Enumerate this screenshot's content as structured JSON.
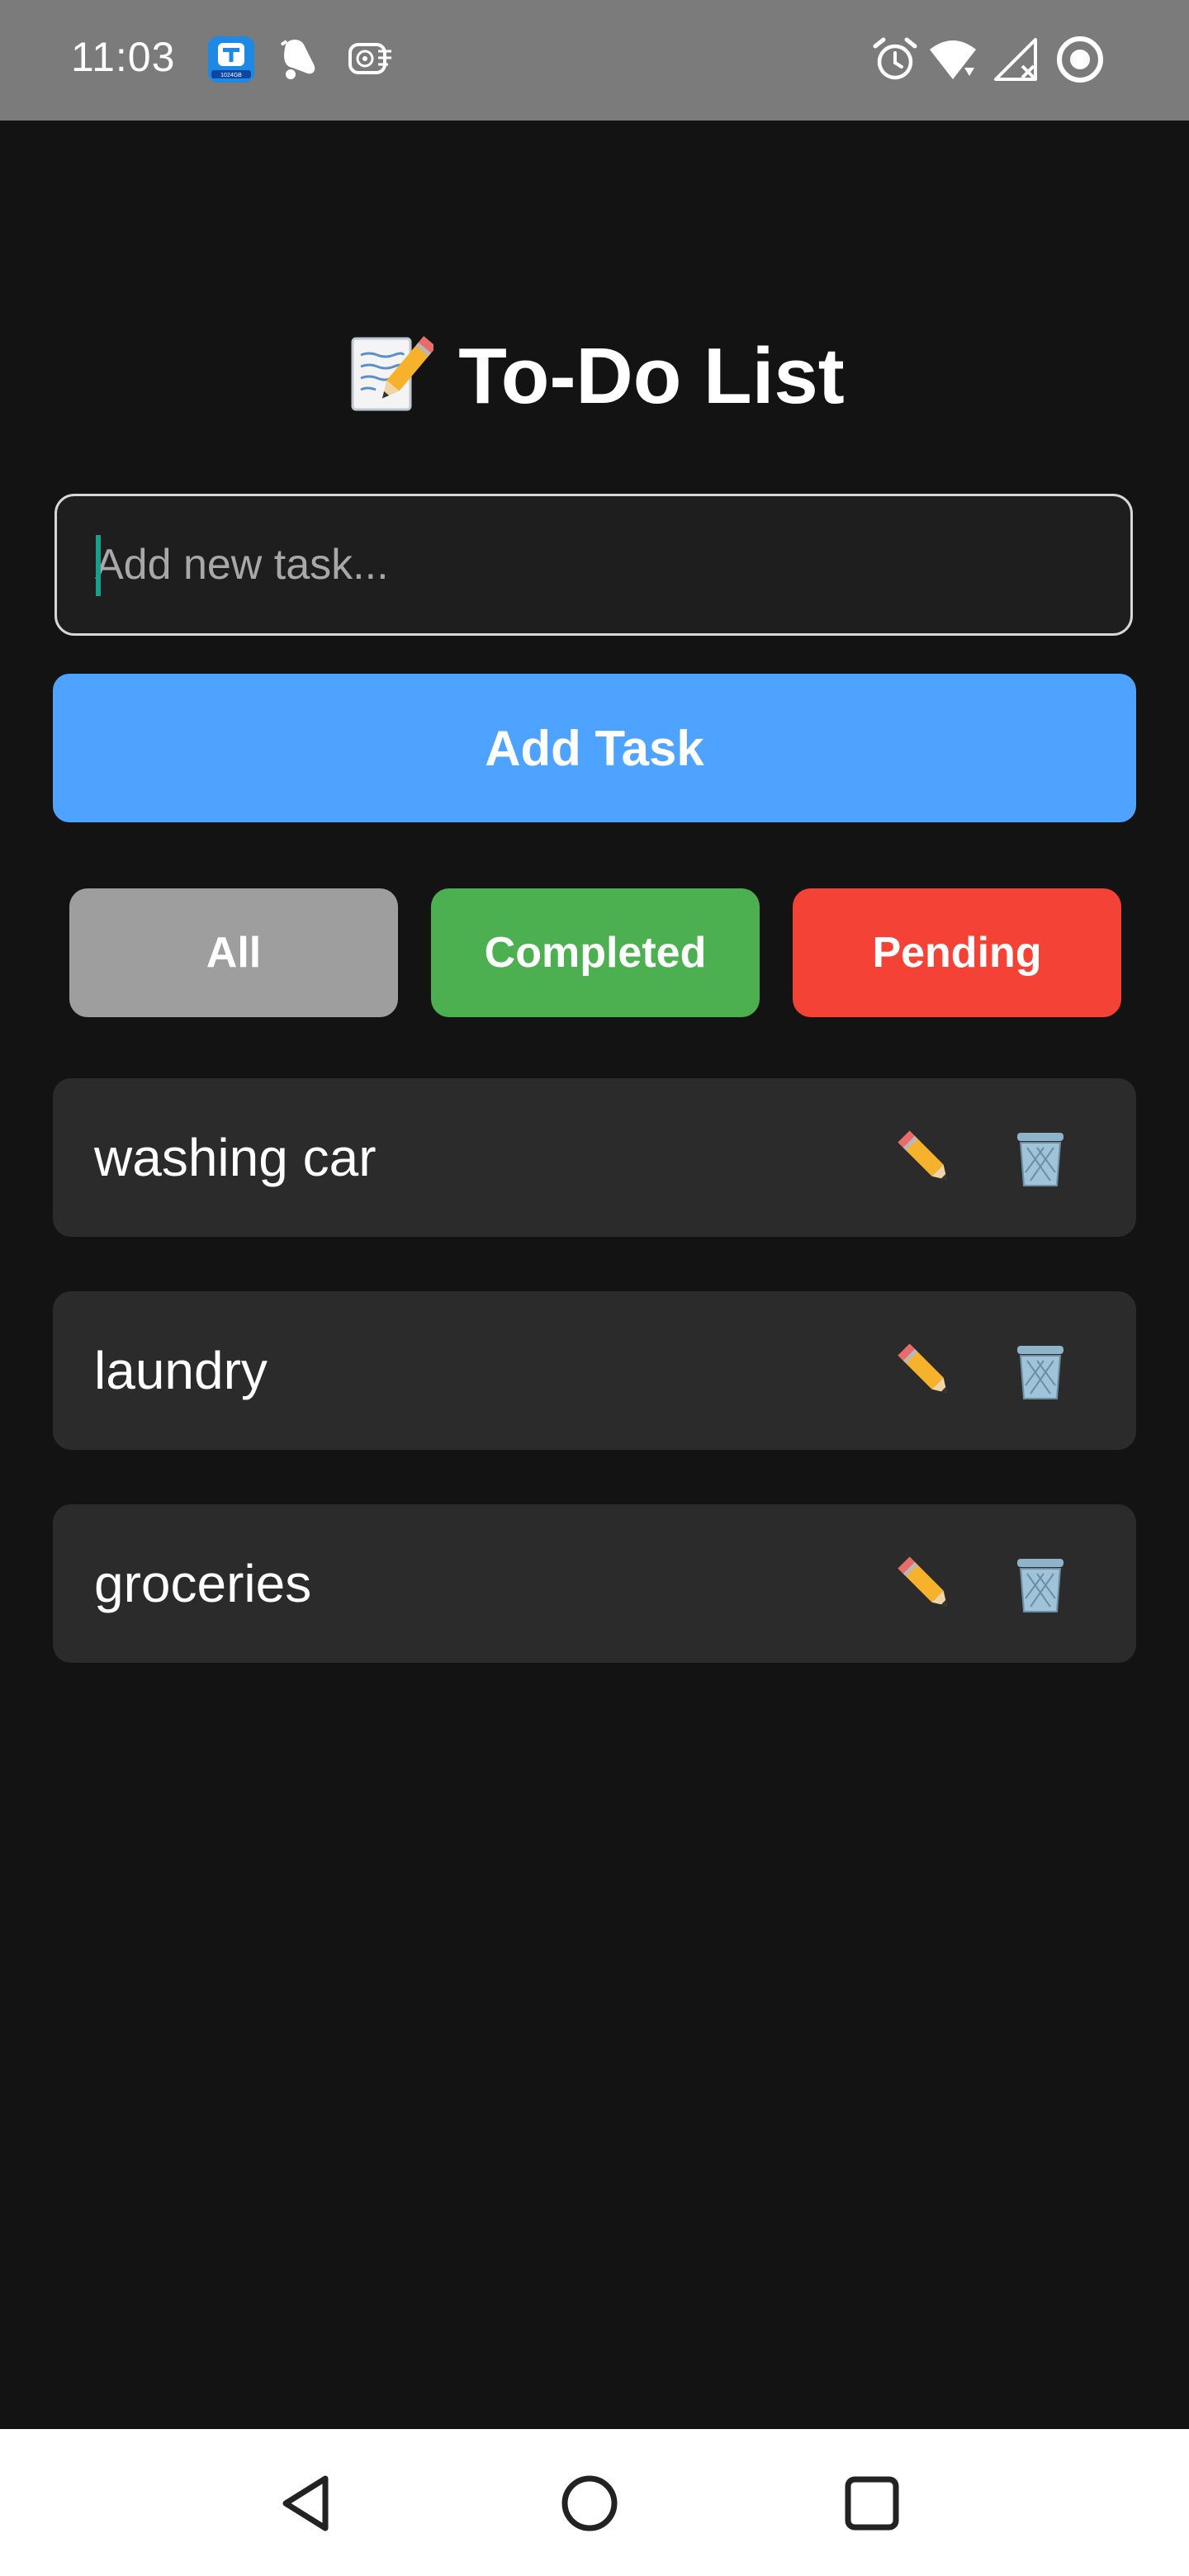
{
  "status_bar": {
    "time": "11:03",
    "left_icons": [
      "storage-app-icon",
      "notification-bell-icon",
      "fan-icon"
    ],
    "right_icons": [
      "alarm-icon",
      "wifi-icon",
      "signal-off-icon",
      "screen-record-icon"
    ],
    "app_badge_text": "1024GB"
  },
  "app": {
    "title": "To-Do List",
    "title_icon": "memo-pencil-icon",
    "input_placeholder": "Add new task...",
    "add_button_label": "Add Task",
    "filters": [
      {
        "label": "All",
        "color": "#9e9e9e"
      },
      {
        "label": "Completed",
        "color": "#4caf50"
      },
      {
        "label": "Pending",
        "color": "#f44336"
      }
    ],
    "tasks": [
      {
        "text": "washing car"
      },
      {
        "text": "laundry"
      },
      {
        "text": "groceries"
      }
    ],
    "accent_color": "#4da3ff",
    "background_color": "#131313",
    "card_color": "#2b2b2b"
  },
  "nav_bar": {
    "buttons": [
      "back-icon",
      "home-icon",
      "recents-icon"
    ]
  }
}
